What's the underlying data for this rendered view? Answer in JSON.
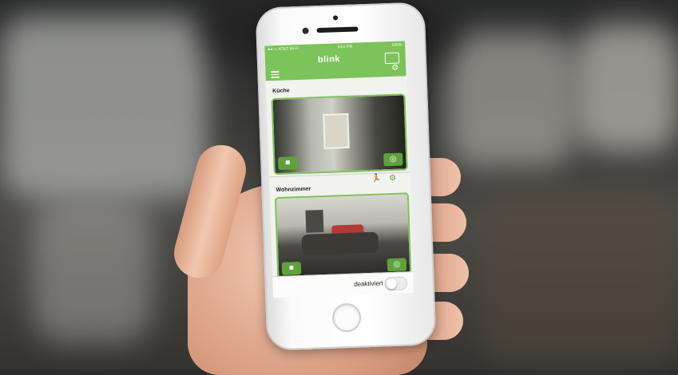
{
  "statusbar": {
    "carrier": "●●○○ AT&T Wi-Fi",
    "time": "6:01 PM",
    "battery": "100%"
  },
  "header": {
    "app_title": "blink"
  },
  "cameras": [
    {
      "name": "Küche"
    },
    {
      "name": "Wohnzimmer"
    }
  ],
  "footer": {
    "system_status": "deaktiviert"
  },
  "colors": {
    "accent": "#7cc35a"
  },
  "icons": {
    "menu": "menu-icon",
    "folder": "folder-icon",
    "settings": "gear-icon",
    "video": "video-camera-icon",
    "snapshot": "photo-camera-icon",
    "motion": "motion-icon"
  }
}
